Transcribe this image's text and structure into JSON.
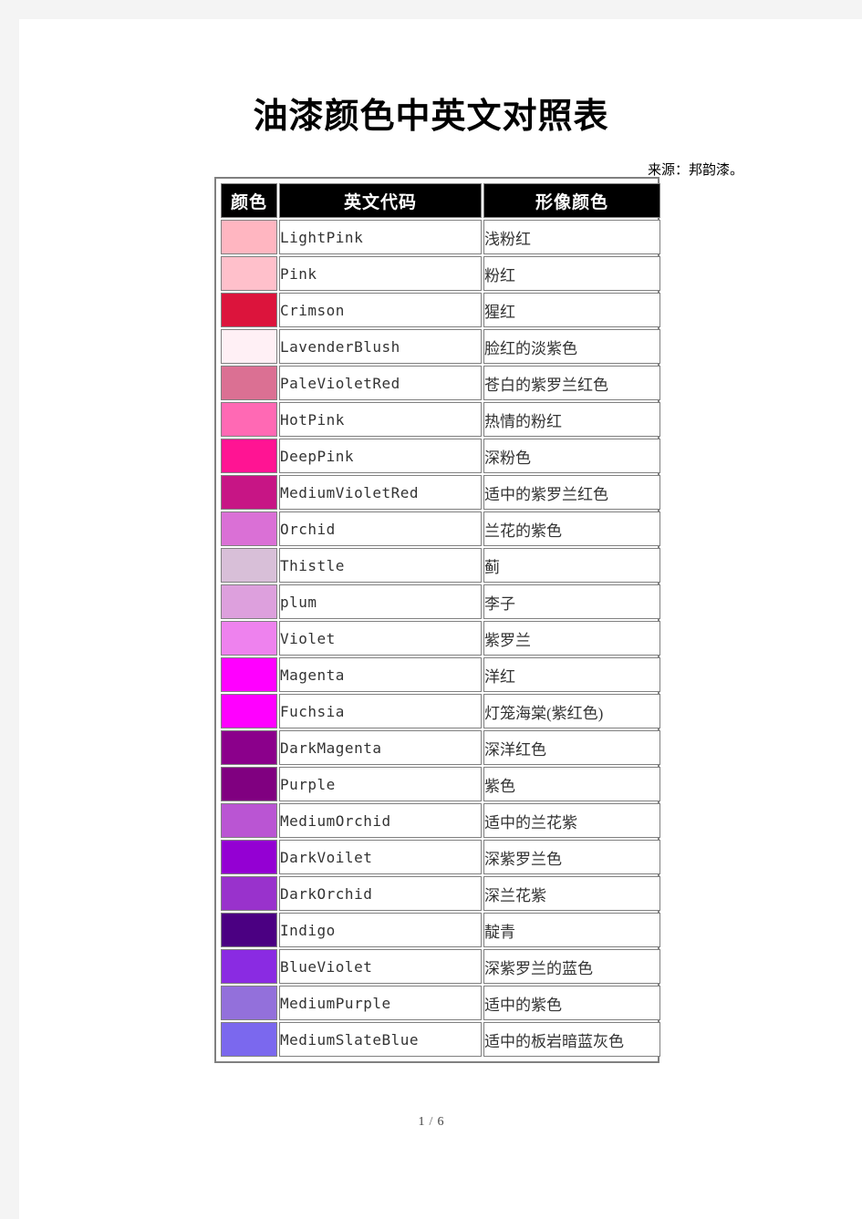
{
  "document": {
    "title": "油漆颜色中英文对照表",
    "source": "来源：邦韵漆。",
    "footer": {
      "current_page": "1",
      "separator": "/",
      "total_pages": "6"
    }
  },
  "table": {
    "headers": {
      "swatch": "颜色",
      "code": "英文代码",
      "chinese": "形像颜色"
    },
    "rows": [
      {
        "color": "#FFB6C1",
        "code": "LightPink",
        "chinese": "浅粉红"
      },
      {
        "color": "#FFC0CB",
        "code": "Pink",
        "chinese": "粉红"
      },
      {
        "color": "#DC143C",
        "code": "Crimson",
        "chinese": "猩红"
      },
      {
        "color": "#FFF0F5",
        "code": "LavenderBlush",
        "chinese": "脸红的淡紫色"
      },
      {
        "color": "#DB7093",
        "code": "PaleVioletRed",
        "chinese": "苍白的紫罗兰红色"
      },
      {
        "color": "#FF69B4",
        "code": "HotPink",
        "chinese": "热情的粉红"
      },
      {
        "color": "#FF1493",
        "code": "DeepPink",
        "chinese": "深粉色"
      },
      {
        "color": "#C71585",
        "code": "MediumVioletRed",
        "chinese": "适中的紫罗兰红色"
      },
      {
        "color": "#DA70D6",
        "code": "Orchid",
        "chinese": "兰花的紫色"
      },
      {
        "color": "#D8BFD8",
        "code": "Thistle",
        "chinese": "蓟"
      },
      {
        "color": "#DDA0DD",
        "code": "plum",
        "chinese": "李子"
      },
      {
        "color": "#EE82EE",
        "code": "Violet",
        "chinese": "紫罗兰"
      },
      {
        "color": "#FF00FF",
        "code": "Magenta",
        "chinese": "洋红"
      },
      {
        "color": "#FF00FF",
        "code": "Fuchsia",
        "chinese": "灯笼海棠(紫红色)"
      },
      {
        "color": "#8B008B",
        "code": "DarkMagenta",
        "chinese": "深洋红色"
      },
      {
        "color": "#800080",
        "code": "Purple",
        "chinese": "紫色"
      },
      {
        "color": "#BA55D3",
        "code": "MediumOrchid",
        "chinese": "适中的兰花紫"
      },
      {
        "color": "#9400D3",
        "code": "DarkVoilet",
        "chinese": "深紫罗兰色"
      },
      {
        "color": "#9932CC",
        "code": "DarkOrchid",
        "chinese": "深兰花紫"
      },
      {
        "color": "#4B0082",
        "code": "Indigo",
        "chinese": "靛青"
      },
      {
        "color": "#8A2BE2",
        "code": "BlueViolet",
        "chinese": "深紫罗兰的蓝色"
      },
      {
        "color": "#9370DB",
        "code": "MediumPurple",
        "chinese": "适中的紫色"
      },
      {
        "color": "#7B68EE",
        "code": "MediumSlateBlue",
        "chinese": "适中的板岩暗蓝灰色"
      }
    ]
  }
}
